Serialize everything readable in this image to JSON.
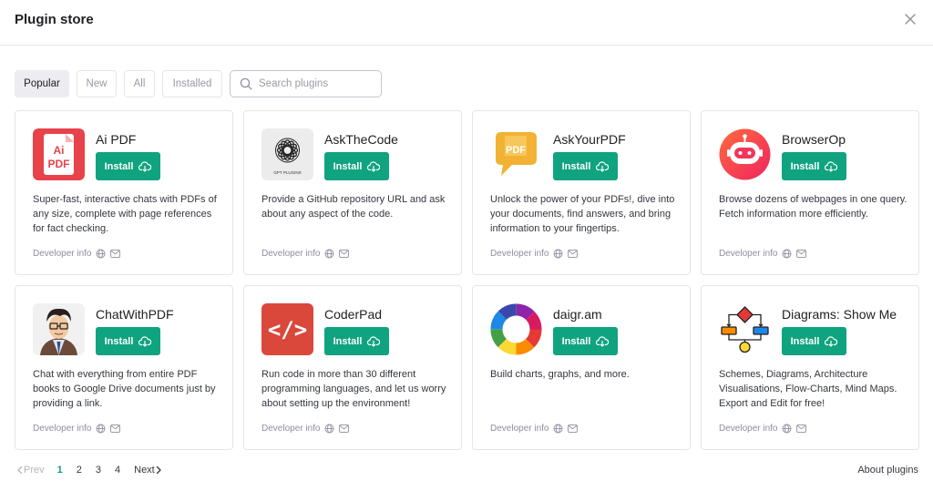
{
  "header": {
    "title": "Plugin store"
  },
  "filters": [
    "Popular",
    "New",
    "All",
    "Installed"
  ],
  "search": {
    "placeholder": "Search plugins",
    "value": ""
  },
  "plugins": [
    {
      "name": "Ai PDF",
      "install_label": "Install",
      "description": "Super-fast, interactive chats with PDFs of any size, complete with page references for fact checking.",
      "developer_label": "Developer info"
    },
    {
      "name": "AskTheCode",
      "install_label": "Install",
      "description": "Provide a GitHub repository URL and ask about any aspect of the code.",
      "developer_label": "Developer info"
    },
    {
      "name": "AskYourPDF",
      "install_label": "Install",
      "description": "Unlock the power of your PDFs!, dive into your documents, find answers, and bring information to your fingertips.",
      "developer_label": "Developer info"
    },
    {
      "name": "BrowserOp",
      "install_label": "Install",
      "description": "Browse dozens of webpages in one query. Fetch information more efficiently.",
      "developer_label": "Developer info"
    },
    {
      "name": "ChatWithPDF",
      "install_label": "Install",
      "description": "Chat with everything from entire PDF books to Google Drive documents just by providing a link.",
      "developer_label": "Developer info"
    },
    {
      "name": "CoderPad",
      "install_label": "Install",
      "description": "Run code in more than 30 different programming languages, and let us worry about setting up the environment!",
      "developer_label": "Developer info"
    },
    {
      "name": "daigr.am",
      "install_label": "Install",
      "description": "Build charts, graphs, and more.",
      "developer_label": "Developer info"
    },
    {
      "name": "Diagrams: Show Me",
      "install_label": "Install",
      "description": "Schemes, Diagrams, Architecture Visualisations, Flow-Charts, Mind Maps. Export and Edit for free!",
      "developer_label": "Developer info"
    }
  ],
  "logos": {
    "aipdf_text_top": "Ai",
    "aipdf_text_bottom": "PDF",
    "askthecode_caption": "GPT PLUGINS",
    "askyourpdf_text": "PDF",
    "coderpad_text": "</>"
  },
  "pagination": {
    "prev": "Prev",
    "pages": [
      "1",
      "2",
      "3",
      "4"
    ],
    "current": "1",
    "next": "Next"
  },
  "footer": {
    "about": "About plugins"
  },
  "colors": {
    "accent": "#10a37f",
    "active_filter_bg": "#ececf1",
    "border": "#e5e5e5"
  }
}
